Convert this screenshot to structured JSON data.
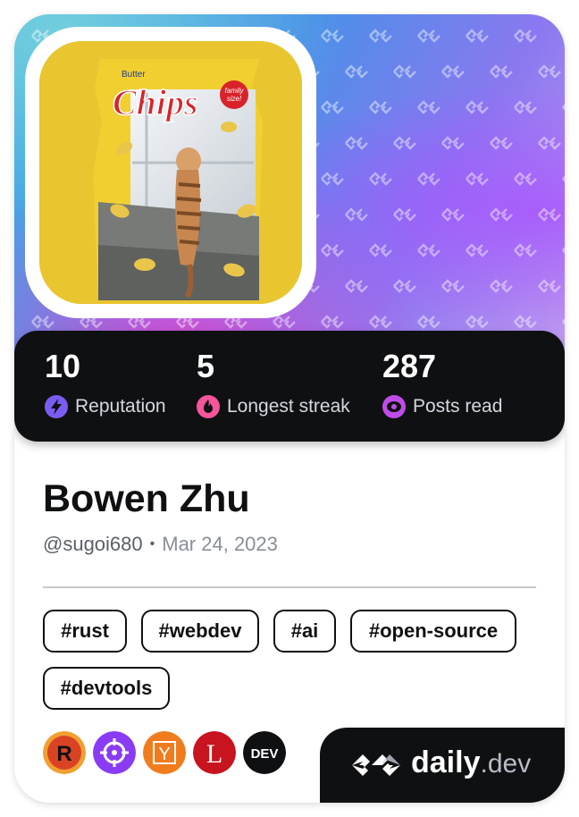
{
  "profile": {
    "name": "Bowen Zhu",
    "handle": "@sugoi680",
    "joined": "Mar 24, 2023"
  },
  "avatar": {
    "bag_brand": "Chips",
    "bag_badge": "family size!",
    "bag_top": "Butter"
  },
  "stats": [
    {
      "value": "10",
      "label": "Reputation",
      "icon": "lightning-icon",
      "color": "#7a5cf0"
    },
    {
      "value": "5",
      "label": "Longest streak",
      "icon": "flame-icon",
      "color": "#f5559a"
    },
    {
      "value": "287",
      "label": "Posts read",
      "icon": "eye-icon",
      "color": "#c04ce8"
    }
  ],
  "tags": [
    "#rust",
    "#webdev",
    "#ai",
    "#open-source",
    "#devtools"
  ],
  "sources": [
    {
      "name": "rust-logo-icon",
      "letter": "R",
      "color": "#d94323"
    },
    {
      "name": "crosshair-logo-icon",
      "letter": "",
      "color": "#8a3cf5"
    },
    {
      "name": "hacker-news-logo-icon",
      "letter": "Y",
      "color": "#f07c1e"
    },
    {
      "name": "l-logo-icon",
      "letter": "L",
      "color": "#c8141e"
    },
    {
      "name": "dev-to-logo-icon",
      "letter": "DEV",
      "color": "#0f1012"
    }
  ],
  "brand": {
    "name": "daily",
    "suffix": ".dev"
  }
}
